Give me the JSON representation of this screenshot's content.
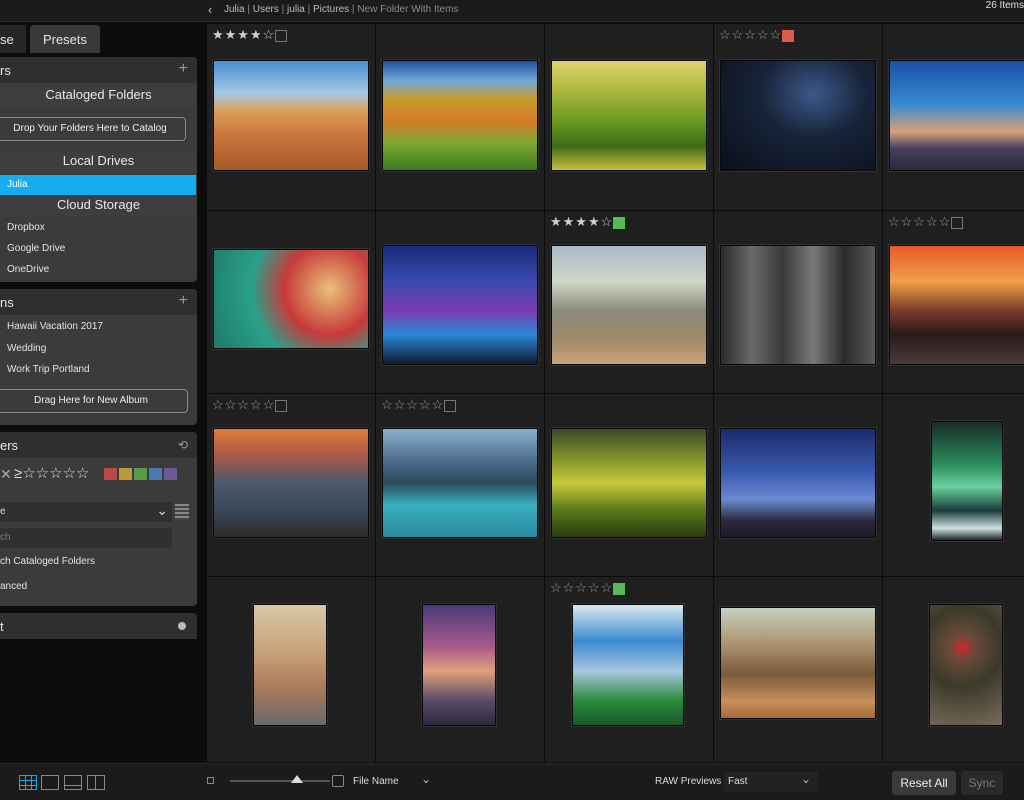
{
  "topbar": {
    "back_icon": "chevron-left-icon",
    "breadcrumb": [
      "Julia",
      "Users",
      "julia",
      "Pictures",
      "New Folder With Items"
    ],
    "item_count": "26 Items"
  },
  "sidebar": {
    "tabs": [
      "se",
      "Presets"
    ],
    "folders": {
      "title": "rs",
      "cataloged_header": "Cataloged Folders",
      "drop_button": "Drop Your Folders Here to Catalog",
      "local_header": "Local Drives",
      "local_items": [
        "Julia"
      ],
      "cloud_header": "Cloud Storage",
      "cloud_items": [
        "Dropbox",
        "Google Drive",
        "OneDrive"
      ]
    },
    "albums": {
      "title": "ns",
      "items": [
        "Hawaii Vacation 2017",
        "Wedding",
        "Work Trip Portland"
      ],
      "new_album_button": "Drag Here for New Album"
    },
    "filters": {
      "title": "ers",
      "rating_prefix": "≥☆☆☆☆☆",
      "color_swatches": [
        "#b84a4a",
        "#b89a3a",
        "#5a9a4a",
        "#4a7ab0",
        "#6a5a9a"
      ],
      "dropdown_value": "e",
      "search_placeholder": "ch",
      "search_cataloged": "ch Cataloged Folders",
      "advanced": "anced"
    },
    "last_panel": {
      "title": "t"
    }
  },
  "grid": {
    "cells": [
      {
        "stars": "★★★★☆",
        "filled": true,
        "label": "empty",
        "photo": "desert-camel"
      },
      {
        "stars": "",
        "label": "none",
        "photo": "fields-tree"
      },
      {
        "stars": "",
        "label": "none",
        "photo": "green-hills"
      },
      {
        "stars": "☆☆☆☆☆",
        "filled": false,
        "label": "red",
        "photo": "night-sky"
      },
      {
        "stars": "",
        "label": "none",
        "photo": "pier-dusk"
      },
      {
        "stars": "",
        "label": "none",
        "photo": "holiday-treats"
      },
      {
        "stars": "",
        "label": "none",
        "photo": "city-night"
      },
      {
        "stars": "★★★★☆",
        "filled": true,
        "label": "green",
        "photo": "elephants"
      },
      {
        "stars": "",
        "label": "none",
        "photo": "foggy-forest"
      },
      {
        "stars": "☆☆☆☆☆",
        "filled": false,
        "label": "empty",
        "photo": "rocky-sunset"
      },
      {
        "stars": "☆☆☆☆☆",
        "filled": false,
        "label": "empty",
        "photo": "seascape-rocks"
      },
      {
        "stars": "☆☆☆☆☆",
        "filled": false,
        "label": "empty",
        "photo": "mountain-lake"
      },
      {
        "stars": "",
        "label": "none",
        "photo": "valley-light"
      },
      {
        "stars": "",
        "label": "none",
        "photo": "starry-mountains"
      },
      {
        "stars": "",
        "label": "none",
        "photo": "aurora"
      },
      {
        "stars": "",
        "label": "none",
        "photo": "winding-road"
      },
      {
        "stars": "",
        "label": "none",
        "photo": "pier-sunset"
      },
      {
        "stars": "☆☆☆☆☆",
        "filled": false,
        "label": "green",
        "photo": "palm-trees"
      },
      {
        "stars": "",
        "label": "none",
        "photo": "hiker-forest"
      },
      {
        "stars": "",
        "label": "none",
        "photo": "dry-grass"
      }
    ]
  },
  "bottombar": {
    "view_buttons": [
      "grid-view-icon",
      "single-view-icon",
      "filmstrip-view-icon",
      "compare-view-icon"
    ],
    "sort_label": "File Name",
    "raw_label": "RAW Previews",
    "raw_value": "Fast",
    "reset_all": "Reset All",
    "sync": "Sync"
  },
  "colors": {
    "accent": "#14aef0",
    "label_red": "#e05a4f",
    "label_green": "#56b85a"
  }
}
